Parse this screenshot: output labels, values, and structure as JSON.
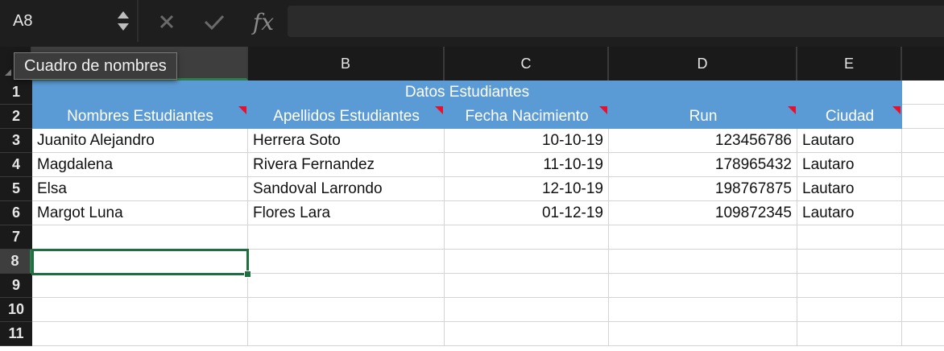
{
  "name_box": {
    "value": "A8"
  },
  "formula_bar": {
    "fx_label": "fx",
    "value": ""
  },
  "tooltip": {
    "text": "Cuadro de nombres"
  },
  "columns": [
    "B",
    "C",
    "D",
    "E"
  ],
  "rows": [
    "1",
    "2",
    "3",
    "4",
    "5",
    "6",
    "7",
    "8",
    "9",
    "10",
    "11"
  ],
  "selected_cell": "A8",
  "table": {
    "title": "Datos Estudiantes",
    "headers": [
      "Nombres Estudiantes",
      "Apellidos Estudiantes",
      "Fecha Nacimiento",
      "Run",
      "Ciudad"
    ],
    "data": [
      [
        "Juanito Alejandro",
        "Herrera Soto",
        "10-10-19",
        "123456786",
        "Lautaro"
      ],
      [
        "Magdalena",
        "Rivera Fernandez",
        "11-10-19",
        "178965432",
        "Lautaro"
      ],
      [
        "Elsa",
        "Sandoval Larrondo",
        "12-10-19",
        "198767875",
        "Lautaro"
      ],
      [
        "Margot Luna",
        "Flores Lara",
        "01-12-19",
        "109872345",
        "Lautaro"
      ]
    ]
  },
  "colors": {
    "header_fill": "#5b9bd5",
    "selection": "#1e6f3f",
    "comment_indicator": "#e8112d"
  }
}
